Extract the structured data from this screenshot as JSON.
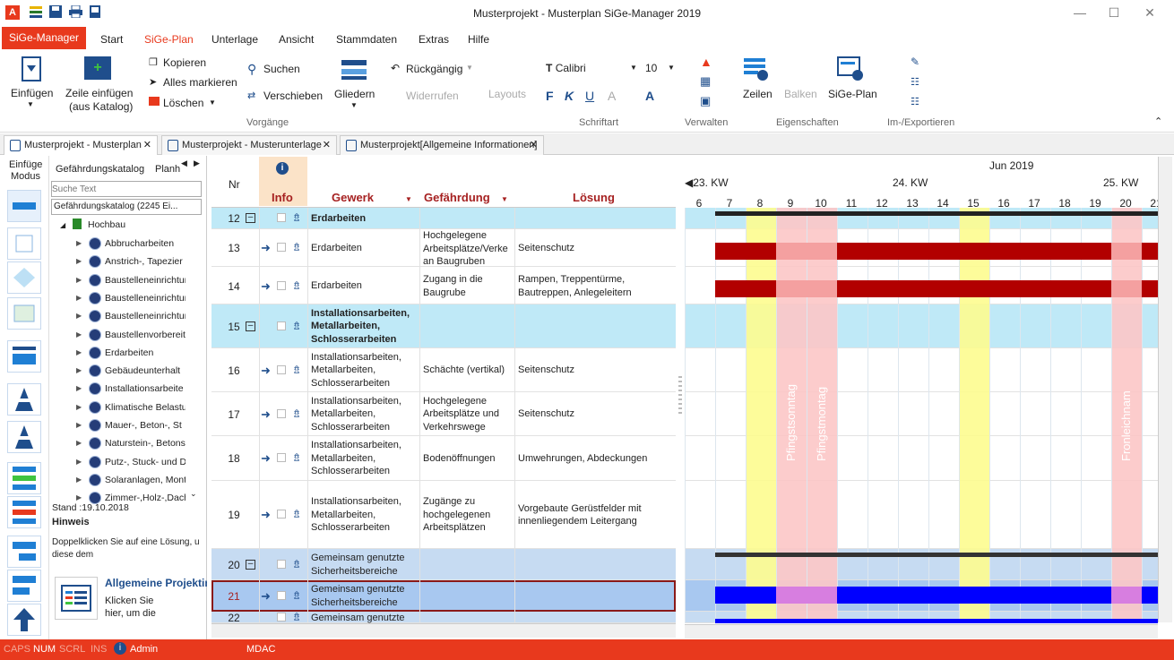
{
  "window": {
    "title": "Musterprojekt - Musterplan SiGe-Manager 2019"
  },
  "menu": {
    "app": "SiGe-Manager",
    "items": [
      "Start",
      "SiGe-Plan",
      "Unterlage",
      "Ansicht",
      "Stammdaten",
      "Extras",
      "Hilfe"
    ]
  },
  "ribbon": {
    "einfuegen": "Einfügen",
    "zeile1": "Zeile einfügen",
    "zeile2": "(aus Katalog)",
    "kopieren": "Kopieren",
    "alles": "Alles markieren",
    "loeschen": "Löschen",
    "suchen": "Suchen",
    "verschieben": "Verschieben",
    "gliedern": "Gliedern",
    "rueck": "Rückgängig",
    "wider": "Widerrufen",
    "layouts": "Layouts",
    "font": "Calibri",
    "size": "10",
    "zeilen": "Zeilen",
    "balken": "Balken",
    "sigeplan": "SiGe-Plan",
    "groups": {
      "vorgange": "Vorgänge",
      "schriftart": "Schriftart",
      "verwalten": "Verwalten",
      "eigenschaften": "Eigenschaften",
      "imex": "Im-/Exportieren"
    }
  },
  "tabs": [
    "Musterprojekt - Musterplan",
    "Musterprojekt - Musterunterlage",
    "Musterprojekt[Allgemeine Informationen]"
  ],
  "modebar": {
    "label1": "Einfüge",
    "label2": "Modus"
  },
  "leftpanel": {
    "tab1": "Gefährdungskatalog",
    "tab2": "Planh",
    "search_placeholder": "Suche Text",
    "catalog": "Gefährdungskatalog (2245 Ei...",
    "root": "Hochbau",
    "items": [
      "Abbrucharbeiten",
      "Anstrich-, Tapezier",
      "Baustelleneinrichtur",
      "Baustelleneinrichtur",
      "Baustelleneinrichtur",
      "Baustellenvorbereit",
      "Erdarbeiten",
      "Gebäudeunterhalt",
      "Installationsarbeite",
      "Klimatische Belastu",
      "Mauer-, Beton-, St",
      "Naturstein-, Betons",
      "Putz-, Stuck- und D",
      "Solaranlagen, Mont",
      "Zimmer-,Holz-,Dach"
    ],
    "stand": "Stand :19.10.2018",
    "hinweis": "Hinweis",
    "hint": "Doppelklicken Sie auf eine Lösung, u\ndiese dem",
    "card_title": "Allgemeine Projektin",
    "card_text": "Klicken Sie\nhier, um die"
  },
  "grid": {
    "headers": {
      "nr": "Nr",
      "info": "Info",
      "gewerk": "Gewerk",
      "gef": "Gefährdung",
      "loes": "Lösung"
    },
    "rows": [
      {
        "nr": "12",
        "gewerk": "Erdarbeiten",
        "gef": "",
        "loes": ""
      },
      {
        "nr": "13",
        "gewerk": "Erdarbeiten",
        "gef": "Hochgelegene\nArbeitsplätze/Verke\nan Baugruben",
        "loes": "Seitenschutz"
      },
      {
        "nr": "14",
        "gewerk": "Erdarbeiten",
        "gef": "Zugang in die\nBaugrube",
        "loes": "Rampen, Treppentürme,\nBautreppen, Anlegeleitern"
      },
      {
        "nr": "15",
        "gewerk": "Installationsarbeiten,\nMetallarbeiten,\nSchlosserarbeiten",
        "gef": "",
        "loes": ""
      },
      {
        "nr": "16",
        "gewerk": "Installationsarbeiten,\nMetallarbeiten,\nSchlosserarbeiten",
        "gef": "Schächte (vertikal)",
        "loes": "Seitenschutz"
      },
      {
        "nr": "17",
        "gewerk": "Installationsarbeiten,\nMetallarbeiten,\nSchlosserarbeiten",
        "gef": "Hochgelegene\nArbeitsplätze und\nVerkehrswege",
        "loes": "Seitenschutz"
      },
      {
        "nr": "18",
        "gewerk": "Installationsarbeiten,\nMetallarbeiten,\nSchlosserarbeiten",
        "gef": "Bodenöffnungen",
        "loes": "Umwehrungen, Abdeckungen"
      },
      {
        "nr": "19",
        "gewerk": "Installationsarbeiten,\nMetallarbeiten,\nSchlosserarbeiten",
        "gef": "Zugänge zu\nhochgelegenen\nArbeitsplätzen",
        "loes": "Vorgebaute Gerüstfelder mit\ninnenliegendem Leitergang"
      },
      {
        "nr": "20",
        "gewerk": "Gemeinsam genutzte\nSicherheitsbereiche",
        "gef": "",
        "loes": ""
      },
      {
        "nr": "21",
        "gewerk": "Gemeinsam genutzte\nSicherheitsbereiche",
        "gef": "",
        "loes": ""
      },
      {
        "nr": "22",
        "gewerk": "Gemeinsam genutzte",
        "gef": "",
        "loes": ""
      }
    ]
  },
  "gantt": {
    "month": "Jun 2019",
    "kw23": "23. KW",
    "kw24": "24. KW",
    "kw25": "25. KW",
    "days": [
      "6",
      "7",
      "8",
      "9",
      "10",
      "11",
      "12",
      "13",
      "14",
      "15",
      "16",
      "17",
      "18",
      "19",
      "20",
      "21"
    ],
    "holidays": [
      "Pfingstsonntag",
      "Pfingstmontag",
      "Fronleichnam"
    ]
  },
  "status": {
    "caps": "CAPS",
    "num": "NUM",
    "scrl": "SCRL",
    "ins": "INS",
    "user": "Admin",
    "db": "MDAC"
  },
  "colors": {
    "accent": "#e8391d",
    "group_row": "#bfe9f7",
    "weekend": "#fdfc8f",
    "holiday": "#fcc6c6",
    "bar_red": "#b20000",
    "bar_blue": "#0000ff",
    "selected": "#a8c8f0"
  }
}
